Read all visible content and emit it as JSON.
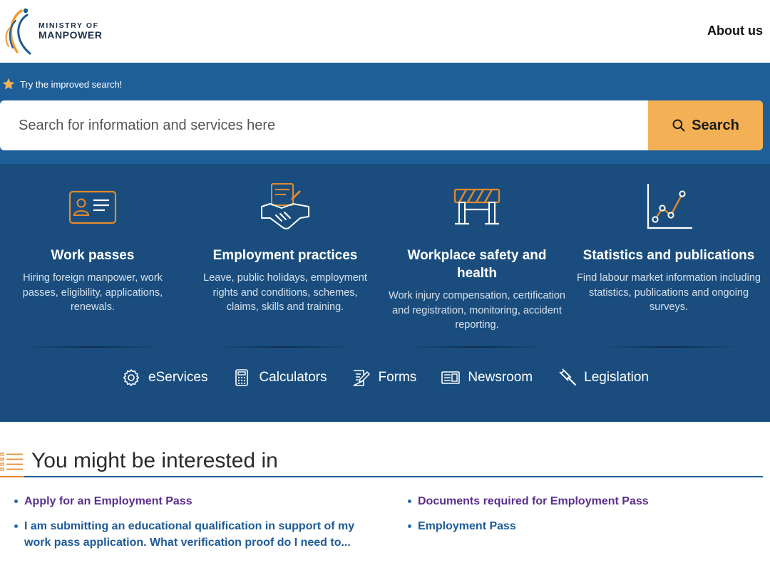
{
  "header": {
    "logo_line1": "MINISTRY OF",
    "logo_line2": "MANPOWER",
    "about_label": "About us"
  },
  "search": {
    "hint": "Try the improved search!",
    "placeholder": "Search for information and services here",
    "button_label": "Search"
  },
  "categories": [
    {
      "icon": "id-card-icon",
      "title": "Work passes",
      "desc": "Hiring foreign manpower, work passes, eligibility, applications, renewals."
    },
    {
      "icon": "handshake-icon",
      "title": "Employment practices",
      "desc": "Leave, public holidays, employment rights and conditions, schemes, claims, skills and training."
    },
    {
      "icon": "barrier-icon",
      "title": "Workplace safety and health",
      "desc": "Work injury compensation, certification and registration, monitoring, accident reporting."
    },
    {
      "icon": "line-chart-icon",
      "title": "Statistics and publications",
      "desc": "Find labour market information including statistics, publications and ongoing surveys."
    }
  ],
  "quicklinks": [
    {
      "icon": "gear-icon",
      "label": "eServices"
    },
    {
      "icon": "calculator-icon",
      "label": "Calculators"
    },
    {
      "icon": "form-icon",
      "label": "Forms"
    },
    {
      "icon": "newspaper-icon",
      "label": "Newsroom"
    },
    {
      "icon": "gavel-icon",
      "label": "Legislation"
    }
  ],
  "interested": {
    "title": "You might be interested in",
    "left": [
      {
        "label": "Apply for an Employment Pass"
      },
      {
        "label": "I am submitting an educational qualification in support of my work pass application. What verification proof do I need to..."
      }
    ],
    "right": [
      {
        "label": "Documents required for Employment Pass"
      },
      {
        "label": "Employment Pass"
      }
    ]
  },
  "colors": {
    "search_band": "#1f5f99",
    "category_band": "#1a4d7e",
    "search_button": "#f4b054",
    "icon_orange": "#e38a2a",
    "link_purple": "#5a2f8c",
    "link_blue": "#1d5b96"
  }
}
